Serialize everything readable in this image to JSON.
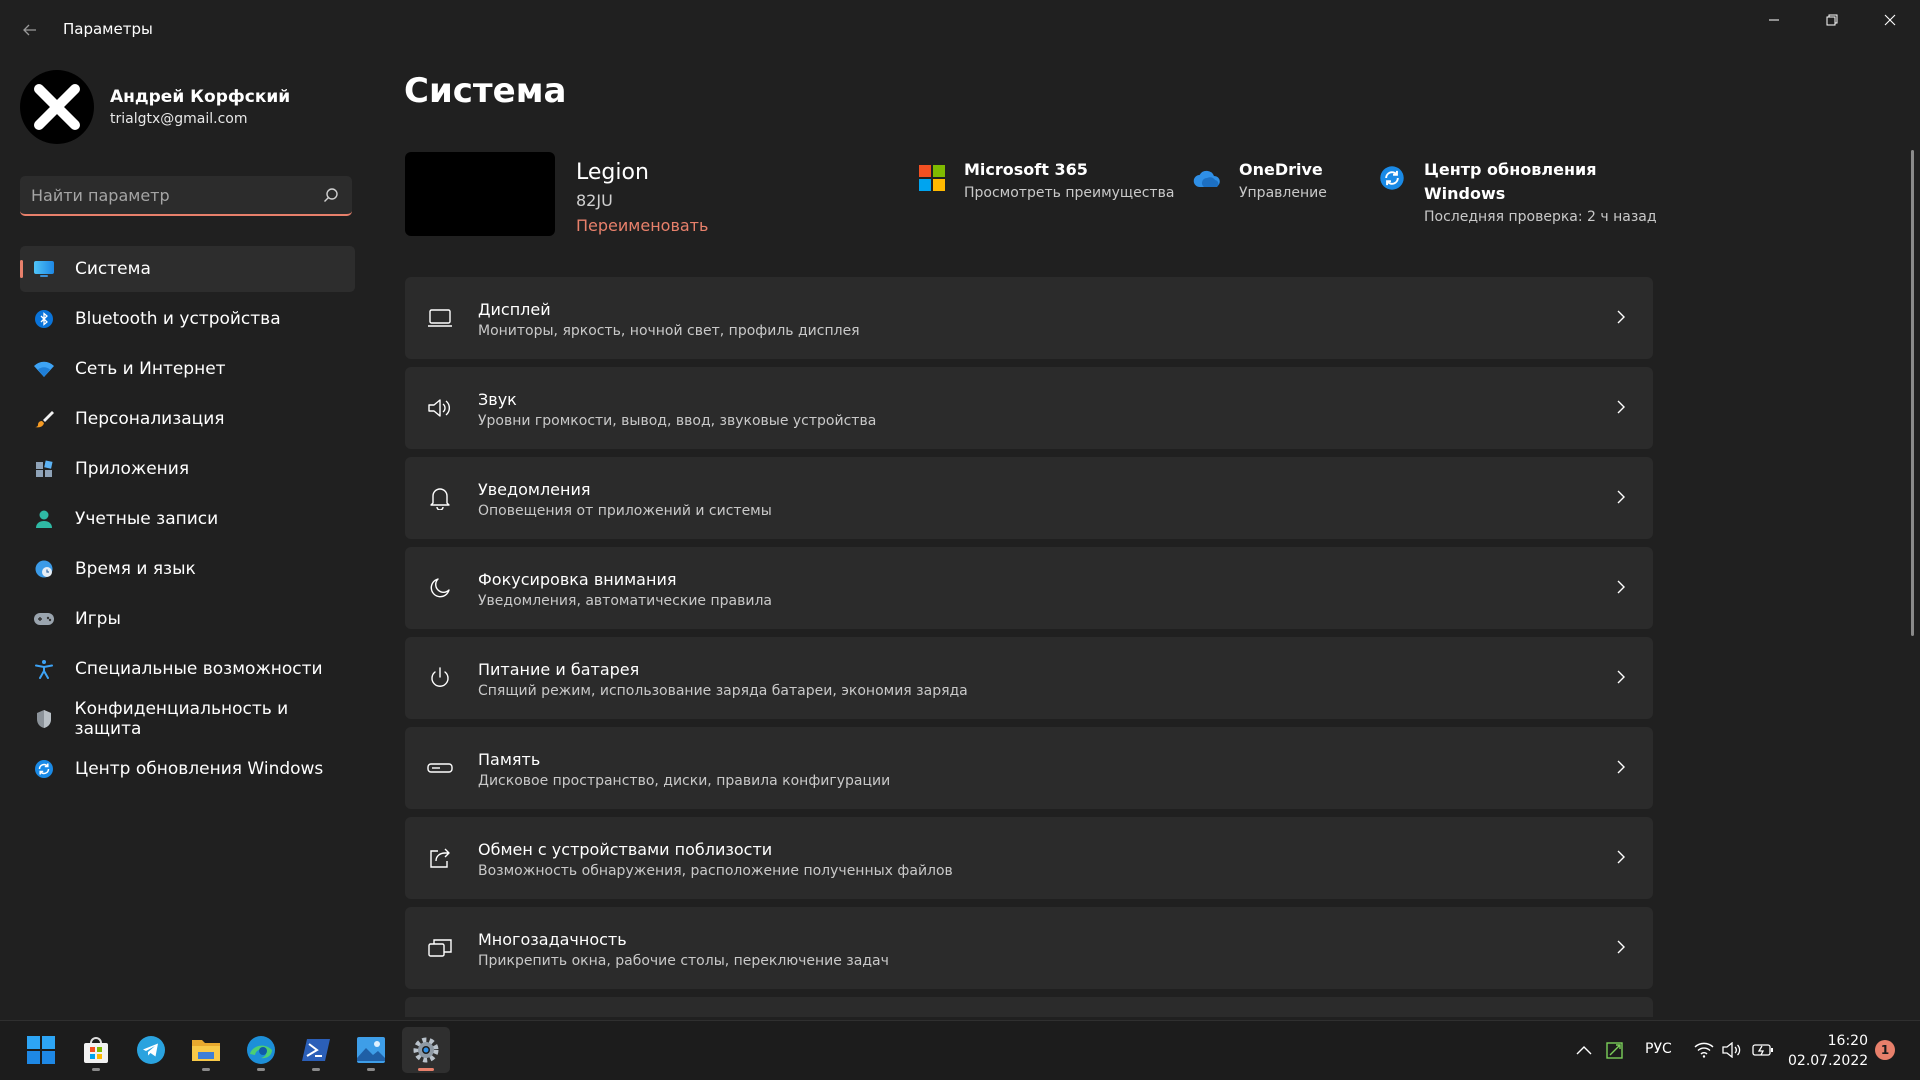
{
  "window": {
    "title": "Параметры"
  },
  "user": {
    "name": "Андрей Корфский",
    "email": "trialgtx@gmail.com"
  },
  "search": {
    "placeholder": "Найти параметр"
  },
  "sidebar": {
    "items": [
      {
        "label": "Система",
        "icon": "system-icon",
        "active": true
      },
      {
        "label": "Bluetooth и устройства",
        "icon": "bluetooth-icon"
      },
      {
        "label": "Сеть и Интернет",
        "icon": "wifi-icon"
      },
      {
        "label": "Персонализация",
        "icon": "brush-icon"
      },
      {
        "label": "Приложения",
        "icon": "apps-icon"
      },
      {
        "label": "Учетные записи",
        "icon": "account-icon"
      },
      {
        "label": "Время и язык",
        "icon": "clock-globe-icon"
      },
      {
        "label": "Игры",
        "icon": "gamepad-icon"
      },
      {
        "label": "Специальные возможности",
        "icon": "accessibility-icon"
      },
      {
        "label": "Конфиденциальность и защита",
        "icon": "shield-icon"
      },
      {
        "label": "Центр обновления Windows",
        "icon": "update-icon"
      }
    ]
  },
  "main": {
    "page_title": "Система",
    "device": {
      "name": "Legion",
      "model": "82JU",
      "rename": "Переименовать"
    },
    "promos": [
      {
        "title": "Microsoft 365",
        "subtitle": "Просмотреть преимущества",
        "icon": "microsoft-logo-icon"
      },
      {
        "title": "OneDrive",
        "subtitle": "Управление",
        "icon": "cloud-icon"
      },
      {
        "title": "Центр обновления\nWindows",
        "subtitle": "Последняя проверка: 2 ч назад",
        "icon": "update-icon"
      }
    ],
    "cards": [
      {
        "title": "Дисплей",
        "desc": "Мониторы, яркость, ночной свет, профиль дисплея",
        "icon": "display-icon"
      },
      {
        "title": "Звук",
        "desc": "Уровни громкости, вывод, ввод, звуковые устройства",
        "icon": "speaker-icon"
      },
      {
        "title": "Уведомления",
        "desc": "Оповещения от приложений и системы",
        "icon": "bell-icon"
      },
      {
        "title": "Фокусировка внимания",
        "desc": "Уведомления, автоматические правила",
        "icon": "moon-icon"
      },
      {
        "title": "Питание и батарея",
        "desc": "Спящий режим, использование заряда батареи, экономия заряда",
        "icon": "power-icon"
      },
      {
        "title": "Память",
        "desc": "Дисковое пространство, диски, правила конфигурации",
        "icon": "storage-icon"
      },
      {
        "title": "Обмен с устройствами поблизости",
        "desc": "Возможность обнаружения, расположение полученных файлов",
        "icon": "share-icon"
      },
      {
        "title": "Многозадачность",
        "desc": "Прикрепить окна, рабочие столы, переключение задач",
        "icon": "multitask-icon"
      }
    ]
  },
  "taskbar": {
    "apps": [
      {
        "name": "start-button",
        "icon": "windows-logo-icon"
      },
      {
        "name": "store-app",
        "icon": "store-icon",
        "running": true
      },
      {
        "name": "telegram-app",
        "icon": "telegram-icon"
      },
      {
        "name": "explorer-app",
        "icon": "folder-icon",
        "running": true
      },
      {
        "name": "edge-app",
        "icon": "edge-icon",
        "running": true
      },
      {
        "name": "powershell-app",
        "icon": "terminal-icon",
        "running": true
      },
      {
        "name": "photos-app",
        "icon": "photos-icon",
        "running": true
      },
      {
        "name": "settings-app",
        "icon": "gear-icon",
        "running": true,
        "active": true
      }
    ],
    "tray": {
      "language": "РУС",
      "time": "16:20",
      "date": "02.07.2022",
      "notifications": "1"
    }
  },
  "colors": {
    "background": "#202020",
    "card": "#2b2b2b",
    "accent": "#e8806b",
    "taskbar": "#1c1c1c"
  }
}
